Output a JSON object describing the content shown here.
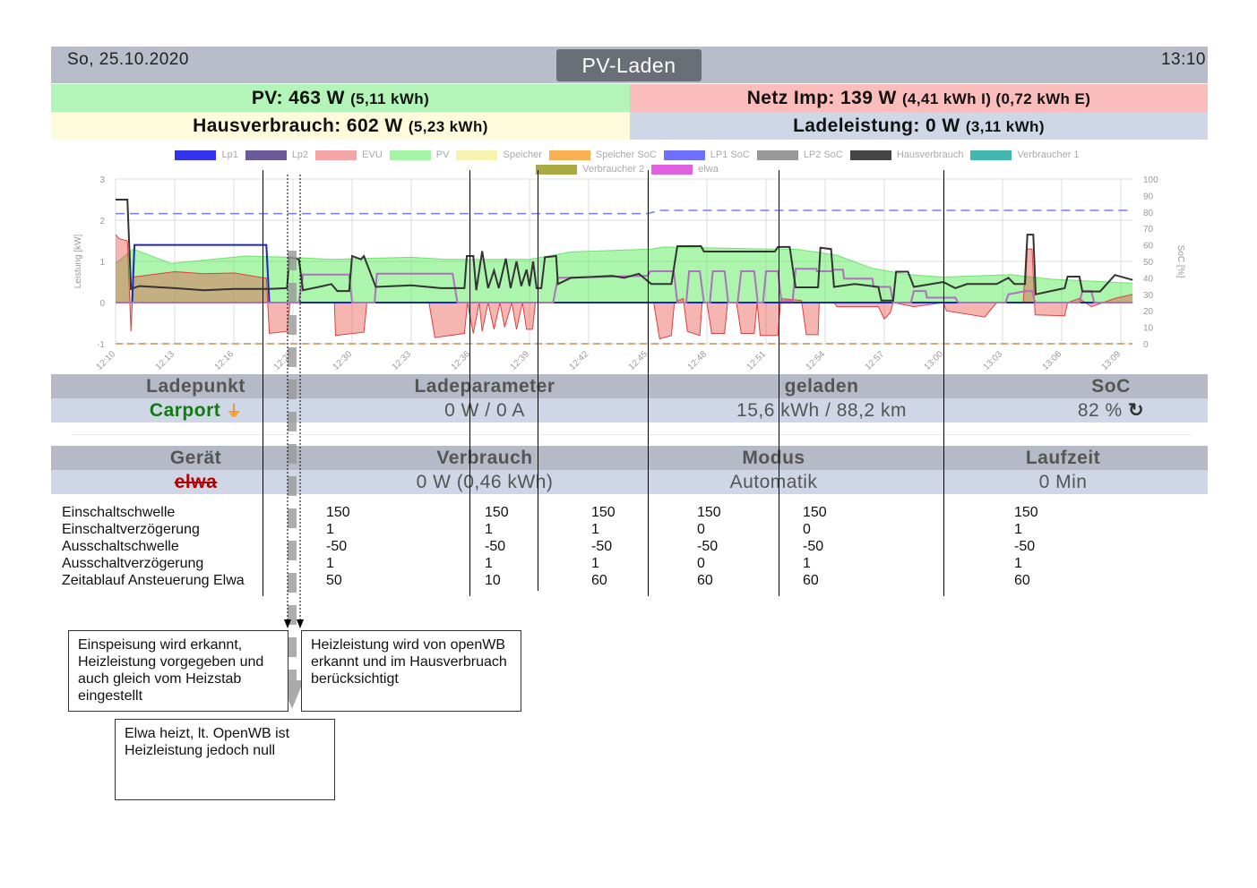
{
  "header": {
    "date": "So, 25.10.2020",
    "mode": "PV-Laden",
    "time": "13:10"
  },
  "summary": {
    "pv": {
      "label": "PV: 463 W",
      "extra": "(5,11 kWh)",
      "color": "#b3f5b8"
    },
    "netz": {
      "label": "Netz Imp: 139 W",
      "extra": "(4,41 kWh I) (0,72 kWh E)",
      "color": "#fbbcbc"
    },
    "haus": {
      "label": "Hausverbrauch: 602 W",
      "extra": "(5,23 kWh)",
      "color": "#fdfbdc"
    },
    "lade": {
      "label": "Ladeleistung: 0 W",
      "extra": "(3,11 kWh)",
      "color": "#cfd6e5"
    }
  },
  "chart_data": {
    "type": "area",
    "legend": [
      {
        "name": "Lp1",
        "color": "#3333ee"
      },
      {
        "name": "Lp2",
        "color": "#6a5a9a"
      },
      {
        "name": "EVU",
        "color": "#f4a6a6"
      },
      {
        "name": "PV",
        "color": "#a6f4a6"
      },
      {
        "name": "Speicher",
        "color": "#f8f4b0"
      },
      {
        "name": "Speicher SoC",
        "color": "#f8b050"
      },
      {
        "name": "LP1 SoC",
        "color": "#7070ff"
      },
      {
        "name": "LP2 SoC",
        "color": "#999999"
      },
      {
        "name": "Hausverbrauch",
        "color": "#444444"
      },
      {
        "name": "Verbraucher 1",
        "color": "#44b8b0"
      },
      {
        "name": "Verbraucher 2",
        "color": "#aaaa44"
      },
      {
        "name": "elwa",
        "color": "#e060e0"
      }
    ],
    "ylabel": "Leistung [kW]",
    "y2label": "SoC [%]",
    "ylim": [
      -1,
      3
    ],
    "yticks": [
      "3",
      "2",
      "1",
      "0",
      "-1"
    ],
    "y2lim": [
      0,
      100
    ],
    "y2ticks": [
      "100",
      "90",
      "80",
      "70",
      "60",
      "50",
      "40",
      "30",
      "20",
      "10",
      "0"
    ],
    "xticks": [
      "12:10",
      "12:13",
      "12:16",
      "12:27",
      "12:30",
      "12:33",
      "12:36",
      "12:39",
      "12:42",
      "12:45",
      "12:48",
      "12:51",
      "12:54",
      "12:57",
      "13:00",
      "13:03",
      "13:06",
      "13:09"
    ],
    "x_unit": "tick index (slot)",
    "series": [
      {
        "name": "PV",
        "kind": "area",
        "points": [
          [
            0,
            0.95
          ],
          [
            0.3,
            1.3
          ],
          [
            0.94,
            0.95
          ],
          [
            2.2,
            1.13
          ],
          [
            2.95,
            1.1
          ],
          [
            3.65,
            1.05
          ],
          [
            5,
            1.1
          ],
          [
            5.6,
            1.05
          ],
          [
            7,
            1.05
          ],
          [
            7.7,
            1.23
          ],
          [
            9.06,
            1.3
          ],
          [
            9.26,
            1.35
          ],
          [
            11.1,
            1.3
          ],
          [
            11.5,
            1.3
          ],
          [
            12.2,
            1.15
          ],
          [
            12.8,
            0.83
          ],
          [
            13.4,
            0.68
          ],
          [
            14,
            0.62
          ],
          [
            15.15,
            0.68
          ],
          [
            15.8,
            0.57
          ],
          [
            17.2,
            0.47
          ]
        ]
      },
      {
        "name": "EVU",
        "kind": "area",
        "points": [
          [
            0,
            1.65
          ],
          [
            0.06,
            1.55
          ],
          [
            0.2,
            1.5
          ],
          [
            0.26,
            -0.7
          ],
          [
            0.3,
            0.62
          ],
          [
            1,
            0.75
          ],
          [
            1.5,
            0.7
          ],
          [
            2.0,
            0.72
          ],
          [
            2.5,
            0.6
          ],
          [
            2.55,
            0.6
          ],
          [
            2.6,
            -0.75
          ],
          [
            2.9,
            -0.7
          ],
          [
            2.95,
            0
          ],
          [
            3.7,
            0
          ],
          [
            3.72,
            -0.8
          ],
          [
            4.2,
            -0.72
          ],
          [
            4.25,
            0
          ],
          [
            5.3,
            0
          ],
          [
            5.4,
            -0.85
          ],
          [
            5.9,
            -0.75
          ],
          [
            5.95,
            0
          ],
          [
            6.05,
            -0.75
          ],
          [
            6.15,
            0
          ],
          [
            6.2,
            -0.7
          ],
          [
            6.3,
            0
          ],
          [
            6.4,
            -0.65
          ],
          [
            6.5,
            0
          ],
          [
            6.58,
            -0.6
          ],
          [
            6.7,
            0
          ],
          [
            6.78,
            -0.65
          ],
          [
            6.88,
            0
          ],
          [
            6.95,
            -0.65
          ],
          [
            7.05,
            -0.65
          ],
          [
            7.1,
            0
          ],
          [
            9.1,
            0
          ],
          [
            9.2,
            -0.88
          ],
          [
            9.4,
            -0.8
          ],
          [
            9.45,
            0
          ],
          [
            9.6,
            0.1
          ],
          [
            9.67,
            -0.7
          ],
          [
            9.88,
            -0.8
          ],
          [
            9.92,
            0
          ],
          [
            10.0,
            0
          ],
          [
            10.08,
            -0.75
          ],
          [
            10.3,
            -0.75
          ],
          [
            10.35,
            0
          ],
          [
            10.5,
            0
          ],
          [
            10.58,
            -0.75
          ],
          [
            10.8,
            -0.75
          ],
          [
            10.85,
            0
          ],
          [
            10.9,
            -0.8
          ],
          [
            11.2,
            -0.8
          ],
          [
            11.25,
            0.1
          ],
          [
            11.6,
            0.05
          ],
          [
            11.68,
            -0.78
          ],
          [
            11.88,
            -0.78
          ],
          [
            11.9,
            0
          ],
          [
            12.15,
            0
          ],
          [
            12.2,
            -0.1
          ],
          [
            12.9,
            -0.1
          ],
          [
            13.0,
            -0.4
          ],
          [
            13.1,
            -0.25
          ],
          [
            13.15,
            0
          ],
          [
            13.5,
            -0.1
          ],
          [
            14.0,
            0
          ],
          [
            14.05,
            -0.2
          ],
          [
            14.7,
            -0.35
          ],
          [
            14.9,
            0
          ],
          [
            15.35,
            0
          ],
          [
            15.4,
            1.3
          ],
          [
            15.5,
            1.3
          ],
          [
            15.55,
            -0.3
          ],
          [
            16.05,
            -0.32
          ],
          [
            16.1,
            0
          ],
          [
            16.3,
            0.1
          ],
          [
            16.5,
            -0.1
          ],
          [
            16.7,
            0
          ],
          [
            16.9,
            0.1
          ],
          [
            17.2,
            0.2
          ]
        ]
      },
      {
        "name": "Lp1",
        "kind": "line",
        "points": [
          [
            0,
            0
          ],
          [
            0.28,
            0
          ],
          [
            0.32,
            1.4
          ],
          [
            2.55,
            1.4
          ],
          [
            2.6,
            0
          ],
          [
            17.2,
            0
          ]
        ]
      },
      {
        "name": "elwa",
        "kind": "line",
        "points": [
          [
            0,
            0
          ],
          [
            3.1,
            0
          ],
          [
            3.17,
            0.68
          ],
          [
            3.95,
            0.68
          ],
          [
            4.0,
            0
          ],
          [
            4.38,
            0
          ],
          [
            4.42,
            0.7
          ],
          [
            5.7,
            0.7
          ],
          [
            5.78,
            0
          ],
          [
            7.4,
            0
          ],
          [
            7.48,
            0.6
          ],
          [
            9.0,
            0.65
          ],
          [
            9.04,
            0.76
          ],
          [
            9.44,
            0.76
          ],
          [
            9.5,
            0
          ],
          [
            9.65,
            0
          ],
          [
            9.7,
            0.76
          ],
          [
            9.88,
            0.76
          ],
          [
            9.95,
            0
          ],
          [
            10.05,
            0
          ],
          [
            10.1,
            0.76
          ],
          [
            10.3,
            0.76
          ],
          [
            10.36,
            0
          ],
          [
            10.52,
            0
          ],
          [
            10.58,
            0.76
          ],
          [
            10.8,
            0.76
          ],
          [
            10.86,
            0
          ],
          [
            10.95,
            0
          ],
          [
            11.0,
            0.76
          ],
          [
            11.2,
            0.76
          ],
          [
            11.26,
            0.04
          ],
          [
            11.45,
            0.04
          ],
          [
            11.5,
            0.82
          ],
          [
            11.85,
            0.82
          ],
          [
            11.86,
            0.76
          ],
          [
            12.1,
            0.76
          ],
          [
            12.15,
            0.8
          ],
          [
            12.3,
            0.8
          ],
          [
            12.32,
            0.58
          ],
          [
            12.8,
            0.58
          ],
          [
            12.82,
            0.38
          ],
          [
            13.1,
            0.38
          ],
          [
            13.15,
            0
          ],
          [
            13.45,
            0
          ],
          [
            13.5,
            0.28
          ],
          [
            13.7,
            0.28
          ],
          [
            13.72,
            0.12
          ],
          [
            14.2,
            0.12
          ],
          [
            14.25,
            0
          ],
          [
            15.05,
            0
          ],
          [
            15.1,
            0.2
          ],
          [
            15.4,
            0.28
          ],
          [
            15.5,
            0.28
          ],
          [
            15.55,
            0
          ],
          [
            16.3,
            0
          ],
          [
            16.35,
            0.28
          ],
          [
            16.5,
            0.28
          ],
          [
            16.55,
            0
          ],
          [
            17.2,
            0
          ]
        ]
      },
      {
        "name": "Hausverbrauch",
        "kind": "line",
        "points": [
          [
            0,
            2.5
          ],
          [
            0.2,
            2.5
          ],
          [
            0.26,
            0.33
          ],
          [
            0.4,
            0.4
          ],
          [
            1,
            0.35
          ],
          [
            1.5,
            0.3
          ],
          [
            2,
            0.33
          ],
          [
            2.6,
            0.33
          ],
          [
            2.9,
            0.35
          ],
          [
            2.94,
            1.1
          ],
          [
            3.1,
            1.05
          ],
          [
            3.17,
            0.3
          ],
          [
            3.5,
            0.4
          ],
          [
            3.65,
            0.45
          ],
          [
            3.75,
            0.28
          ],
          [
            3.95,
            0.28
          ],
          [
            4.0,
            1.13
          ],
          [
            4.15,
            1.05
          ],
          [
            4.2,
            1.13
          ],
          [
            4.4,
            0.38
          ],
          [
            5.0,
            0.42
          ],
          [
            5.5,
            0.35
          ],
          [
            5.9,
            0.35
          ],
          [
            5.94,
            1.13
          ],
          [
            6.05,
            1.13
          ],
          [
            6.1,
            0.3
          ],
          [
            6.2,
            1.25
          ],
          [
            6.3,
            0.35
          ],
          [
            6.4,
            0.78
          ],
          [
            6.48,
            0.35
          ],
          [
            6.6,
            1.07
          ],
          [
            6.68,
            0.35
          ],
          [
            6.78,
            1.0
          ],
          [
            6.86,
            0.4
          ],
          [
            6.95,
            0.8
          ],
          [
            7.0,
            0.4
          ],
          [
            7.06,
            1.0
          ],
          [
            7.12,
            0.35
          ],
          [
            7.2,
            0.35
          ],
          [
            7.26,
            1.1
          ],
          [
            7.45,
            1.13
          ],
          [
            7.48,
            0.45
          ],
          [
            7.7,
            0.6
          ],
          [
            8.0,
            0.62
          ],
          [
            8.4,
            0.65
          ],
          [
            8.6,
            0.6
          ],
          [
            8.85,
            0.7
          ],
          [
            9.06,
            0.45
          ],
          [
            9.4,
            0.45
          ],
          [
            9.5,
            1.37
          ],
          [
            9.9,
            1.37
          ],
          [
            9.95,
            1.24
          ],
          [
            11.15,
            1.24
          ],
          [
            11.2,
            1.35
          ],
          [
            11.4,
            1.35
          ],
          [
            11.5,
            0.37
          ],
          [
            11.88,
            0.37
          ],
          [
            11.92,
            1.33
          ],
          [
            12.1,
            1.3
          ],
          [
            12.15,
            0.38
          ],
          [
            12.5,
            0.45
          ],
          [
            12.9,
            0.38
          ],
          [
            12.95,
            0.05
          ],
          [
            13.15,
            0.05
          ],
          [
            13.2,
            0.75
          ],
          [
            13.4,
            0.75
          ],
          [
            13.5,
            0.38
          ],
          [
            14.0,
            0.5
          ],
          [
            14.2,
            0.35
          ],
          [
            14.4,
            0.45
          ],
          [
            14.9,
            0.45
          ],
          [
            15.1,
            0.6
          ],
          [
            15.2,
            0.45
          ],
          [
            15.38,
            0.45
          ],
          [
            15.42,
            1.65
          ],
          [
            15.52,
            1.65
          ],
          [
            15.56,
            0.2
          ],
          [
            16.05,
            0.35
          ],
          [
            16.1,
            0.63
          ],
          [
            16.3,
            0.63
          ],
          [
            16.35,
            0.27
          ],
          [
            16.65,
            0.27
          ],
          [
            16.9,
            0.67
          ],
          [
            17.2,
            0.55
          ]
        ]
      },
      {
        "name": "LP1 SoC",
        "kind": "dashed",
        "axis": "soc",
        "points": [
          [
            0,
            79
          ],
          [
            9.0,
            79
          ],
          [
            9.2,
            81
          ],
          [
            17.2,
            81
          ]
        ]
      },
      {
        "name": "Speicher SoC",
        "kind": "dashed",
        "axis": "soc",
        "points": [
          [
            0,
            0
          ],
          [
            17.2,
            0
          ]
        ]
      }
    ]
  },
  "ladepunkt_table": {
    "headers": [
      "Ladepunkt",
      "Ladeparameter",
      "geladen",
      "SoC"
    ],
    "row": {
      "name": "Carport",
      "parameter": "0 W / 0 A",
      "geladen": "15,6 kWh / 88,2 km",
      "soc": "82 %"
    }
  },
  "geraet_table": {
    "headers": [
      "Gerät",
      "Verbrauch",
      "Modus",
      "Laufzeit"
    ],
    "row": {
      "name": "elwa",
      "verbrauch": "0 W (0,46 kWh)",
      "modus": "Automatik",
      "laufzeit": "0 Min"
    }
  },
  "params": {
    "labels": [
      "Einschaltschwelle",
      "Einschaltverzögerung",
      "Ausschaltschwelle",
      "Ausschaltverzögerung",
      "Zeitablauf Ansteuerung Elwa"
    ],
    "columns": [
      [
        "150",
        "1",
        "-50",
        "1",
        "50"
      ],
      [
        "150",
        "1",
        "-50",
        "1",
        "10"
      ],
      [
        "150",
        "1",
        "-50",
        "1",
        "60"
      ],
      [
        "150",
        "0",
        "-50",
        "0",
        "60"
      ],
      [
        "150",
        "0",
        "-50",
        "1",
        "60"
      ],
      [
        "150",
        "1",
        "-50",
        "1",
        "60"
      ]
    ]
  },
  "annotations": [
    "Einspeisung wird erkannt, Heizleistung vorgegeben und auch gleich vom Heizstab eingestellt",
    "Heizleistung wird von openWB erkannt und im Hausverbruach berücksichtigt",
    "Elwa heizt, lt. OpenWB ist Heizleistung jedoch null"
  ]
}
